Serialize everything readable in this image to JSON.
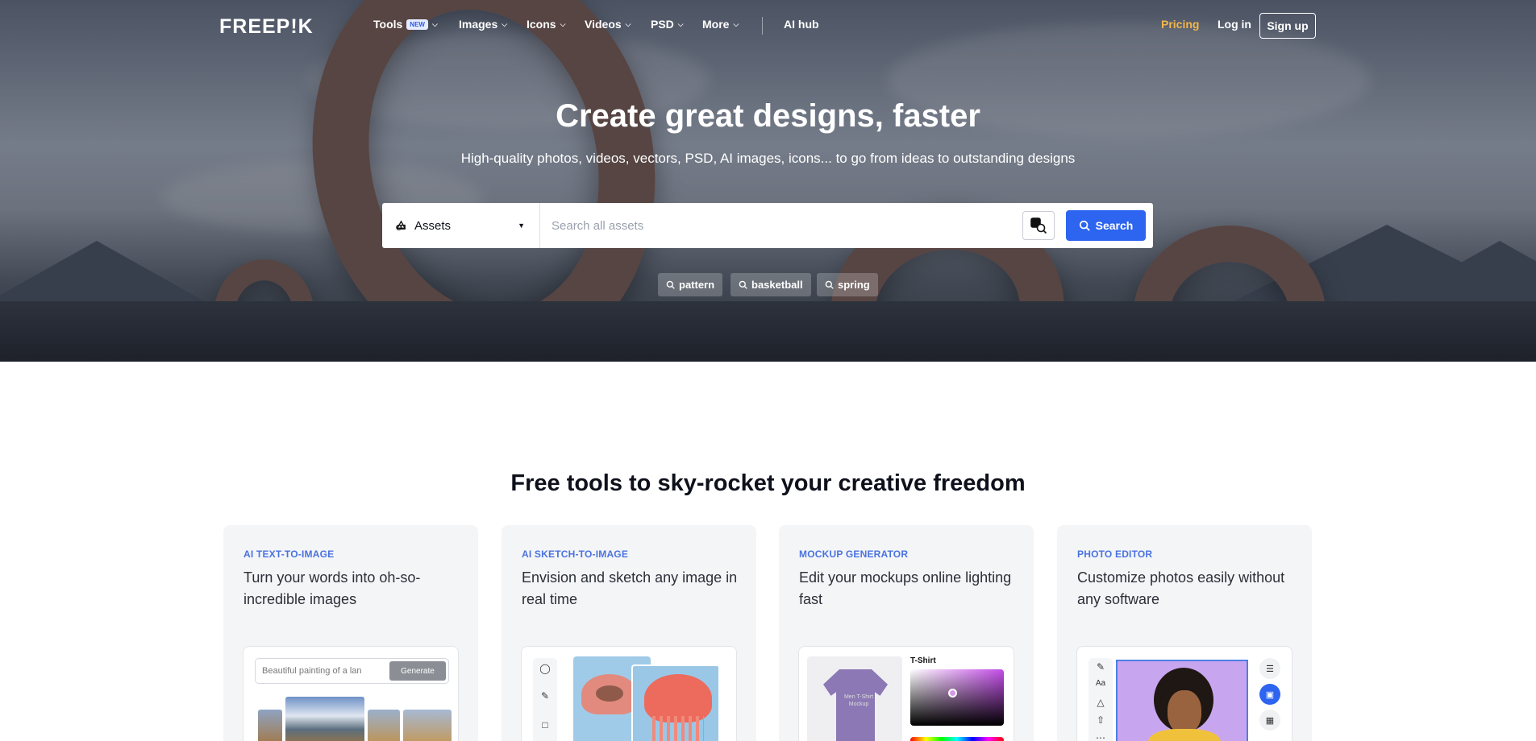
{
  "nav": {
    "logo": "FREEP!K",
    "items": [
      {
        "label": "Tools",
        "badge": "NEW"
      },
      {
        "label": "Images"
      },
      {
        "label": "Icons"
      },
      {
        "label": "Videos"
      },
      {
        "label": "PSD"
      },
      {
        "label": "More"
      }
    ],
    "ai_hub": "AI hub",
    "pricing": "Pricing",
    "login": "Log in",
    "signup": "Sign up"
  },
  "hero": {
    "title": "Create great designs, faster",
    "subtitle": "High-quality photos, videos, vectors, PSD, AI images, icons... to go from ideas to outstanding designs",
    "search": {
      "category": "Assets",
      "placeholder": "Search all assets",
      "button": "Search"
    },
    "suggestions": [
      "pattern",
      "basketball",
      "spring"
    ]
  },
  "tools_section": {
    "title": "Free tools to sky-rocket your creative freedom",
    "cards": [
      {
        "tag": "AI TEXT-TO-IMAGE",
        "description": "Turn your words into oh-so-incredible images",
        "prompt": "Beautiful painting of a lan",
        "button": "Generate"
      },
      {
        "tag": "AI SKETCH-TO-IMAGE",
        "description": "Envision and sketch any image in real time"
      },
      {
        "tag": "MOCKUP GENERATOR",
        "description": "Edit your mockups online lighting fast",
        "panel_label": "T-Shirt",
        "shirt_text": "Men T-Shirt Mockup"
      },
      {
        "tag": "PHOTO EDITOR",
        "description": "Customize photos easily without any software"
      }
    ]
  },
  "colors": {
    "accent": "#2d64f0",
    "pricing": "#f2b64c",
    "tag": "#4a73e0"
  }
}
